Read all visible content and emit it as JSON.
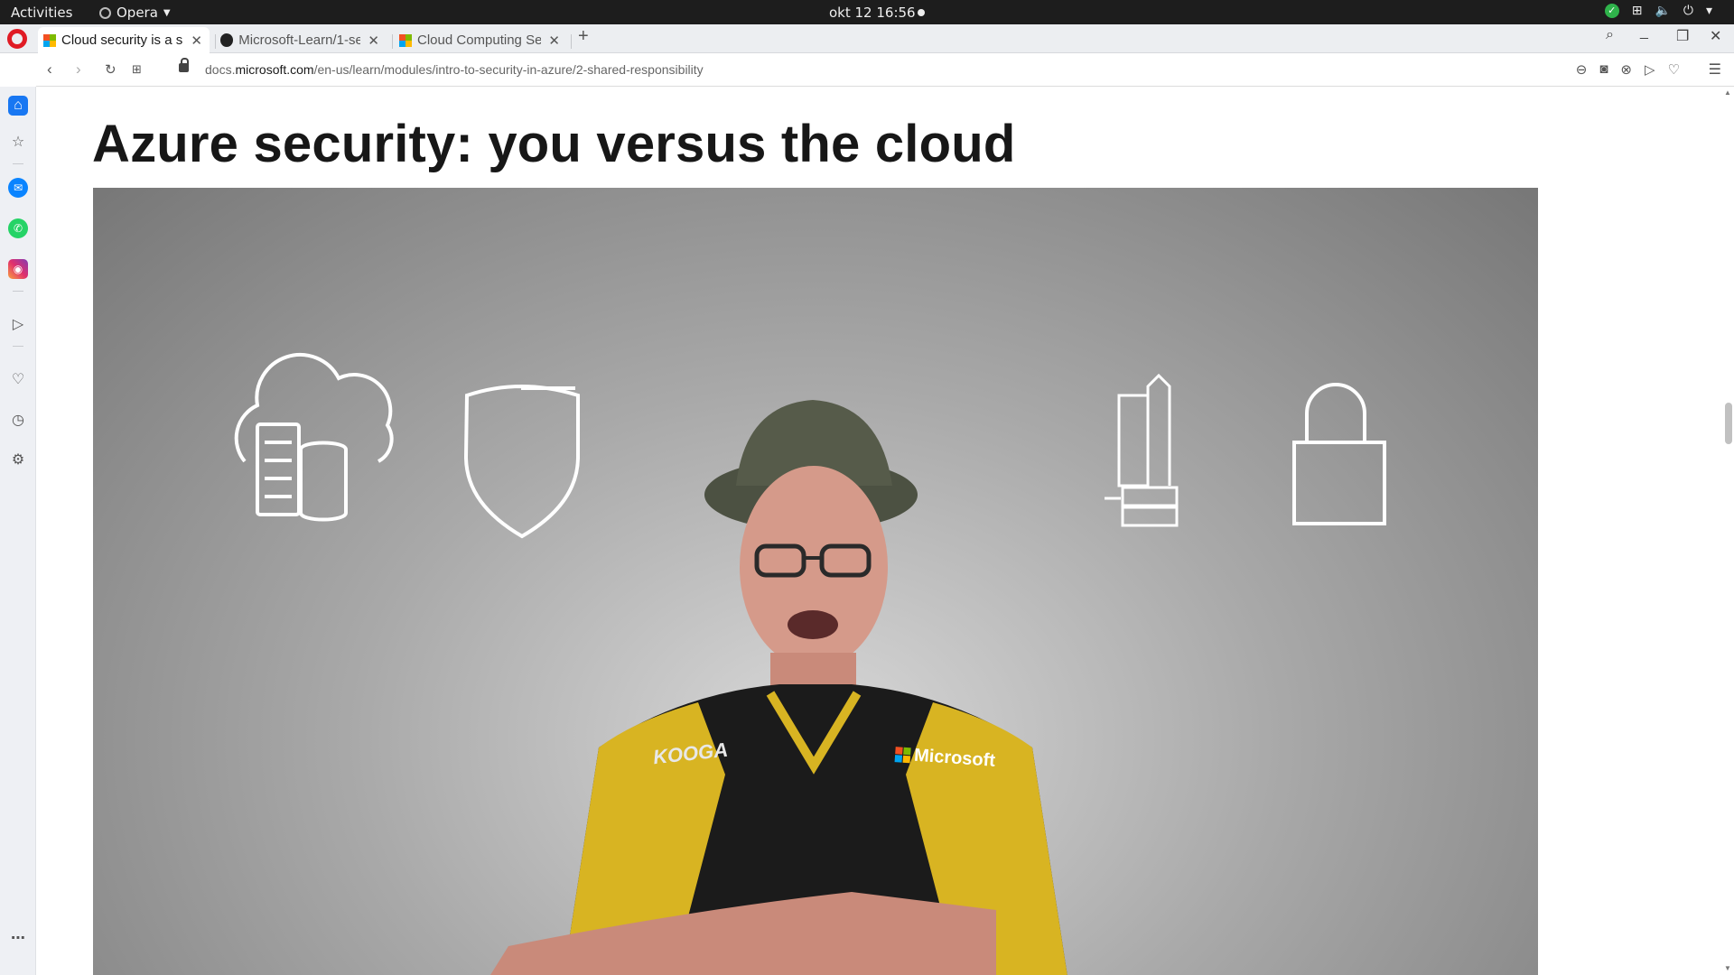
{
  "system_bar": {
    "activities": "Activities",
    "app_name": "Opera",
    "datetime": "okt 12  16:56"
  },
  "tabs": [
    {
      "title": "Cloud security is a sh",
      "active": true
    },
    {
      "title": "Microsoft-Learn/1-se",
      "active": false
    },
    {
      "title": "Cloud Computing Se",
      "active": false
    }
  ],
  "address_bar": {
    "url_prefix": "docs.",
    "url_domain": "microsoft.com",
    "url_path": "/en-us/learn/modules/intro-to-security-in-azure/2-shared-responsibility"
  },
  "page": {
    "title": "Azure security: you versus the cloud"
  },
  "video": {
    "shirt_brand_left": "KOOGA",
    "shirt_brand_right": "Microsoft"
  },
  "colors": {
    "topbar": "#1d1d1d",
    "tabstrip": "#eceef1",
    "accent_home": "#1877f2",
    "title_text": "#171717"
  }
}
